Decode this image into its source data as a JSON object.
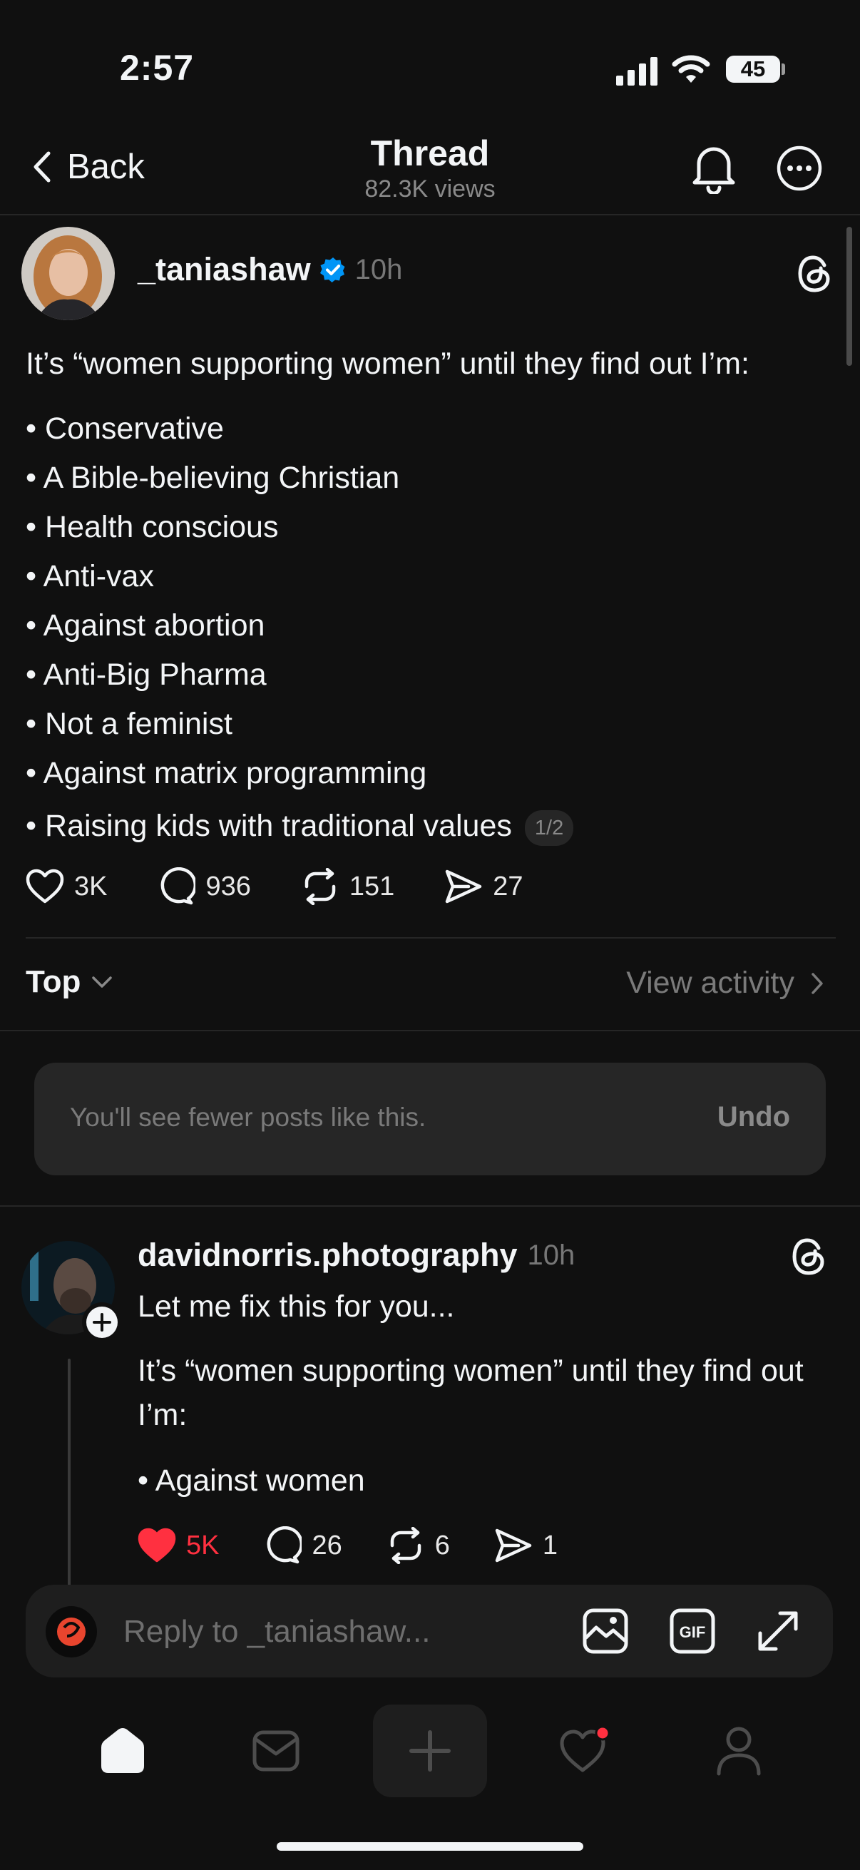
{
  "status_bar": {
    "time": "2:57",
    "battery": "45"
  },
  "header": {
    "back_label": "Back",
    "title": "Thread",
    "views": "82.3K views"
  },
  "post": {
    "username": "_taniashaw",
    "time": "10h",
    "text": "It’s “women supporting women” until they find out I’m:",
    "bullets": [
      "Conservative",
      "A Bible-believing Christian",
      "Health conscious",
      "Anti-vax",
      "Against abortion",
      "Anti-Big Pharma",
      "Not a feminist",
      "Against matrix programming",
      "Raising kids with traditional values"
    ],
    "pager": "1/2",
    "likes": "3K",
    "comments": "936",
    "reposts": "151",
    "shares": "27"
  },
  "sort": {
    "label": "Top",
    "view_activity": "View activity"
  },
  "toast": {
    "text": "You'll see fewer posts like this.",
    "undo": "Undo"
  },
  "reply": {
    "username": "davidnorris.photography",
    "time": "10h",
    "line1": "Let me fix this for you...",
    "line2": "It’s “women supporting women” until they find out I’m:",
    "bullet": "Against women",
    "likes": "5K",
    "comments": "26",
    "reposts": "6",
    "shares": "1"
  },
  "composer": {
    "placeholder": "Reply to _taniashaw..."
  },
  "colors": {
    "background": "#101010",
    "verified": "#0095f6",
    "liked": "#ff3040",
    "muted": "#777777"
  }
}
